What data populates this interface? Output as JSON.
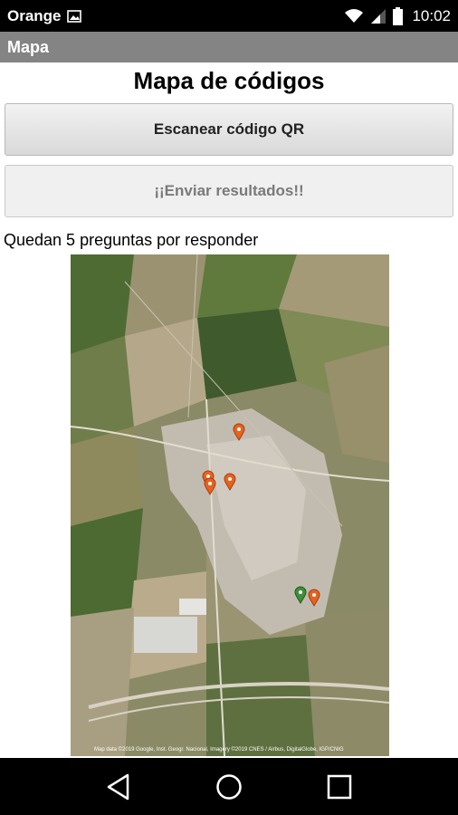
{
  "status_bar": {
    "carrier": "Orange",
    "time": "10:02",
    "icons": [
      "image-icon",
      "wifi-icon",
      "signal-icon",
      "battery-icon"
    ]
  },
  "action_bar": {
    "title": "Mapa"
  },
  "main": {
    "title": "Mapa de códigos",
    "scan_button_label": "Escanear código QR",
    "send_button_label": "¡¡Enviar resultados!!",
    "remaining_text": "Quedan 5 preguntas por responder"
  },
  "map": {
    "attribution": "Map data ©2019 Google, Inst. Geogr. Nacional, Imagery ©2019 CNES / Airbus, DigitalGlobe, IGP/CNIG",
    "markers": [
      "orange",
      "orange",
      "orange",
      "orange",
      "orange",
      "green"
    ]
  },
  "nav_bar": {
    "icons": [
      "back-icon",
      "home-icon",
      "recents-icon"
    ]
  },
  "colors": {
    "status_bar": "#000000",
    "action_bar": "#848484",
    "marker": "#e8621f"
  }
}
